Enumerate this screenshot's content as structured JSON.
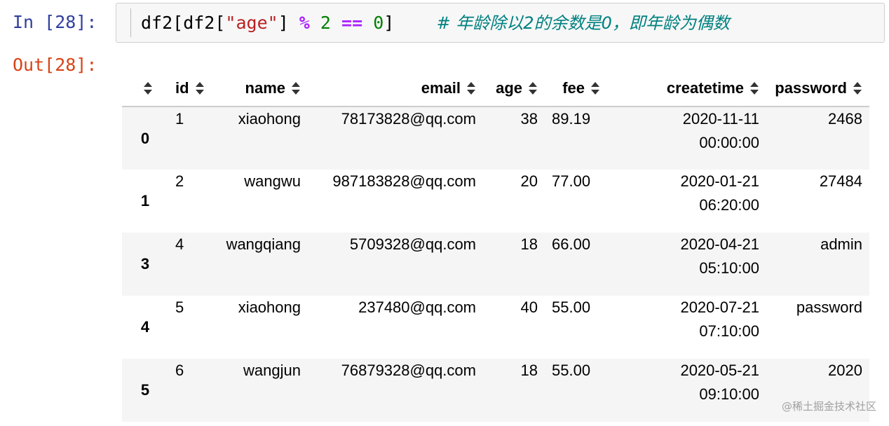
{
  "input_prompt": "In [28]:",
  "output_prompt": "Out[28]:",
  "code": {
    "part1": "df2[df2[",
    "string": "\"age\"",
    "part2": "] ",
    "op_mod": "%",
    "num1": "2",
    "op_eq": "==",
    "num2": "0",
    "part3": "]",
    "comment": "# 年龄除以2的余数是0，即年龄为偶数"
  },
  "table": {
    "columns": [
      "id",
      "name",
      "email",
      "age",
      "fee",
      "createtime",
      "password"
    ],
    "rows": [
      {
        "index": "0",
        "id": "1",
        "name": "xiaohong",
        "email": "78173828@qq.com",
        "age": "38",
        "fee": "89.19",
        "createtime_date": "2020-11-11",
        "createtime_time": "00:00:00",
        "password": "2468"
      },
      {
        "index": "1",
        "id": "2",
        "name": "wangwu",
        "email": "987183828@qq.com",
        "age": "20",
        "fee": "77.00",
        "createtime_date": "2020-01-21",
        "createtime_time": "06:20:00",
        "password": "27484"
      },
      {
        "index": "3",
        "id": "4",
        "name": "wangqiang",
        "email": "5709328@qq.com",
        "age": "18",
        "fee": "66.00",
        "createtime_date": "2020-04-21",
        "createtime_time": "05:10:00",
        "password": "admin"
      },
      {
        "index": "4",
        "id": "5",
        "name": "xiaohong",
        "email": "237480@qq.com",
        "age": "40",
        "fee": "55.00",
        "createtime_date": "2020-07-21",
        "createtime_time": "07:10:00",
        "password": "password"
      },
      {
        "index": "5",
        "id": "6",
        "name": "wangjun",
        "email": "76879328@qq.com",
        "age": "18",
        "fee": "55.00",
        "createtime_date": "2020-05-21",
        "createtime_time": "09:10:00",
        "password": "2020"
      }
    ]
  },
  "watermark": "@稀土掘金技术社区"
}
